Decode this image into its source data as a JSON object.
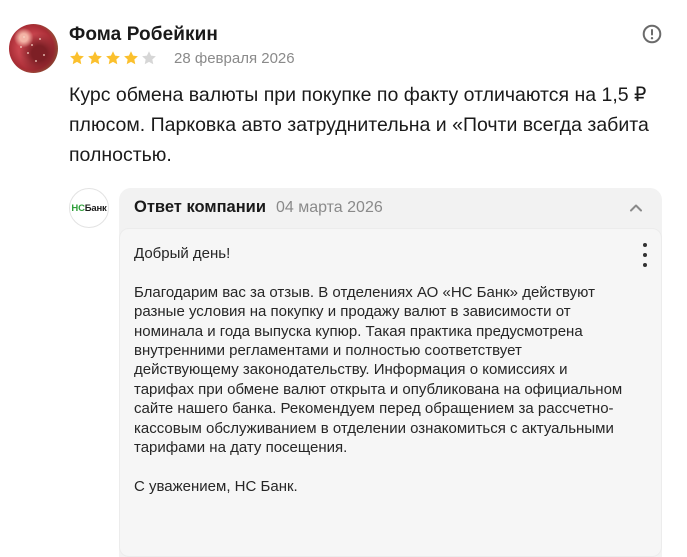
{
  "review": {
    "author": "Фома Робейкин",
    "rating": 4,
    "rating_max": 5,
    "date": "28 февраля 2026",
    "text": "Курс обмена валюты при покупке по факту отличаются на 1,5 ₽ плюсом. Парковка авто затруднительна и «Почти всегда забита полностью.",
    "report_icon": "exclamation-circle-icon"
  },
  "reply": {
    "logo": {
      "part1": "НС",
      "part2": "Банк"
    },
    "title": "Ответ компании",
    "date": "04 марта 2026",
    "collapse_icon": "chevron-up-icon",
    "more_icon": "vertical-dots-icon",
    "greeting": "Добрый день!",
    "body": "Благодарим вас за отзыв. В отделениях АО «НС Банк» действуют разные условия на покупку и продажу валют в зависимости от номинала и года выпуска купюр. Такая практика предусмотрена внутренними регламентами и полностью соответствует действующему законодательству. Информация о комиссиях и тарифах при обмене валют открыта и опубликована на официальном сайте нашего банка. Рекомендуем перед обращением за рассчетно-кассовым обслуживанием в отделении ознакомиться с актуальными тарифами на дату посещения.",
    "signature": "С уважением, НС Банк."
  },
  "colors": {
    "star_filled": "#fbc02d",
    "star_empty": "#d6d6d6",
    "logo_green": "#2f9e3a",
    "reply_bg": "#f2f2f2",
    "muted_text": "#8a8a8a"
  }
}
